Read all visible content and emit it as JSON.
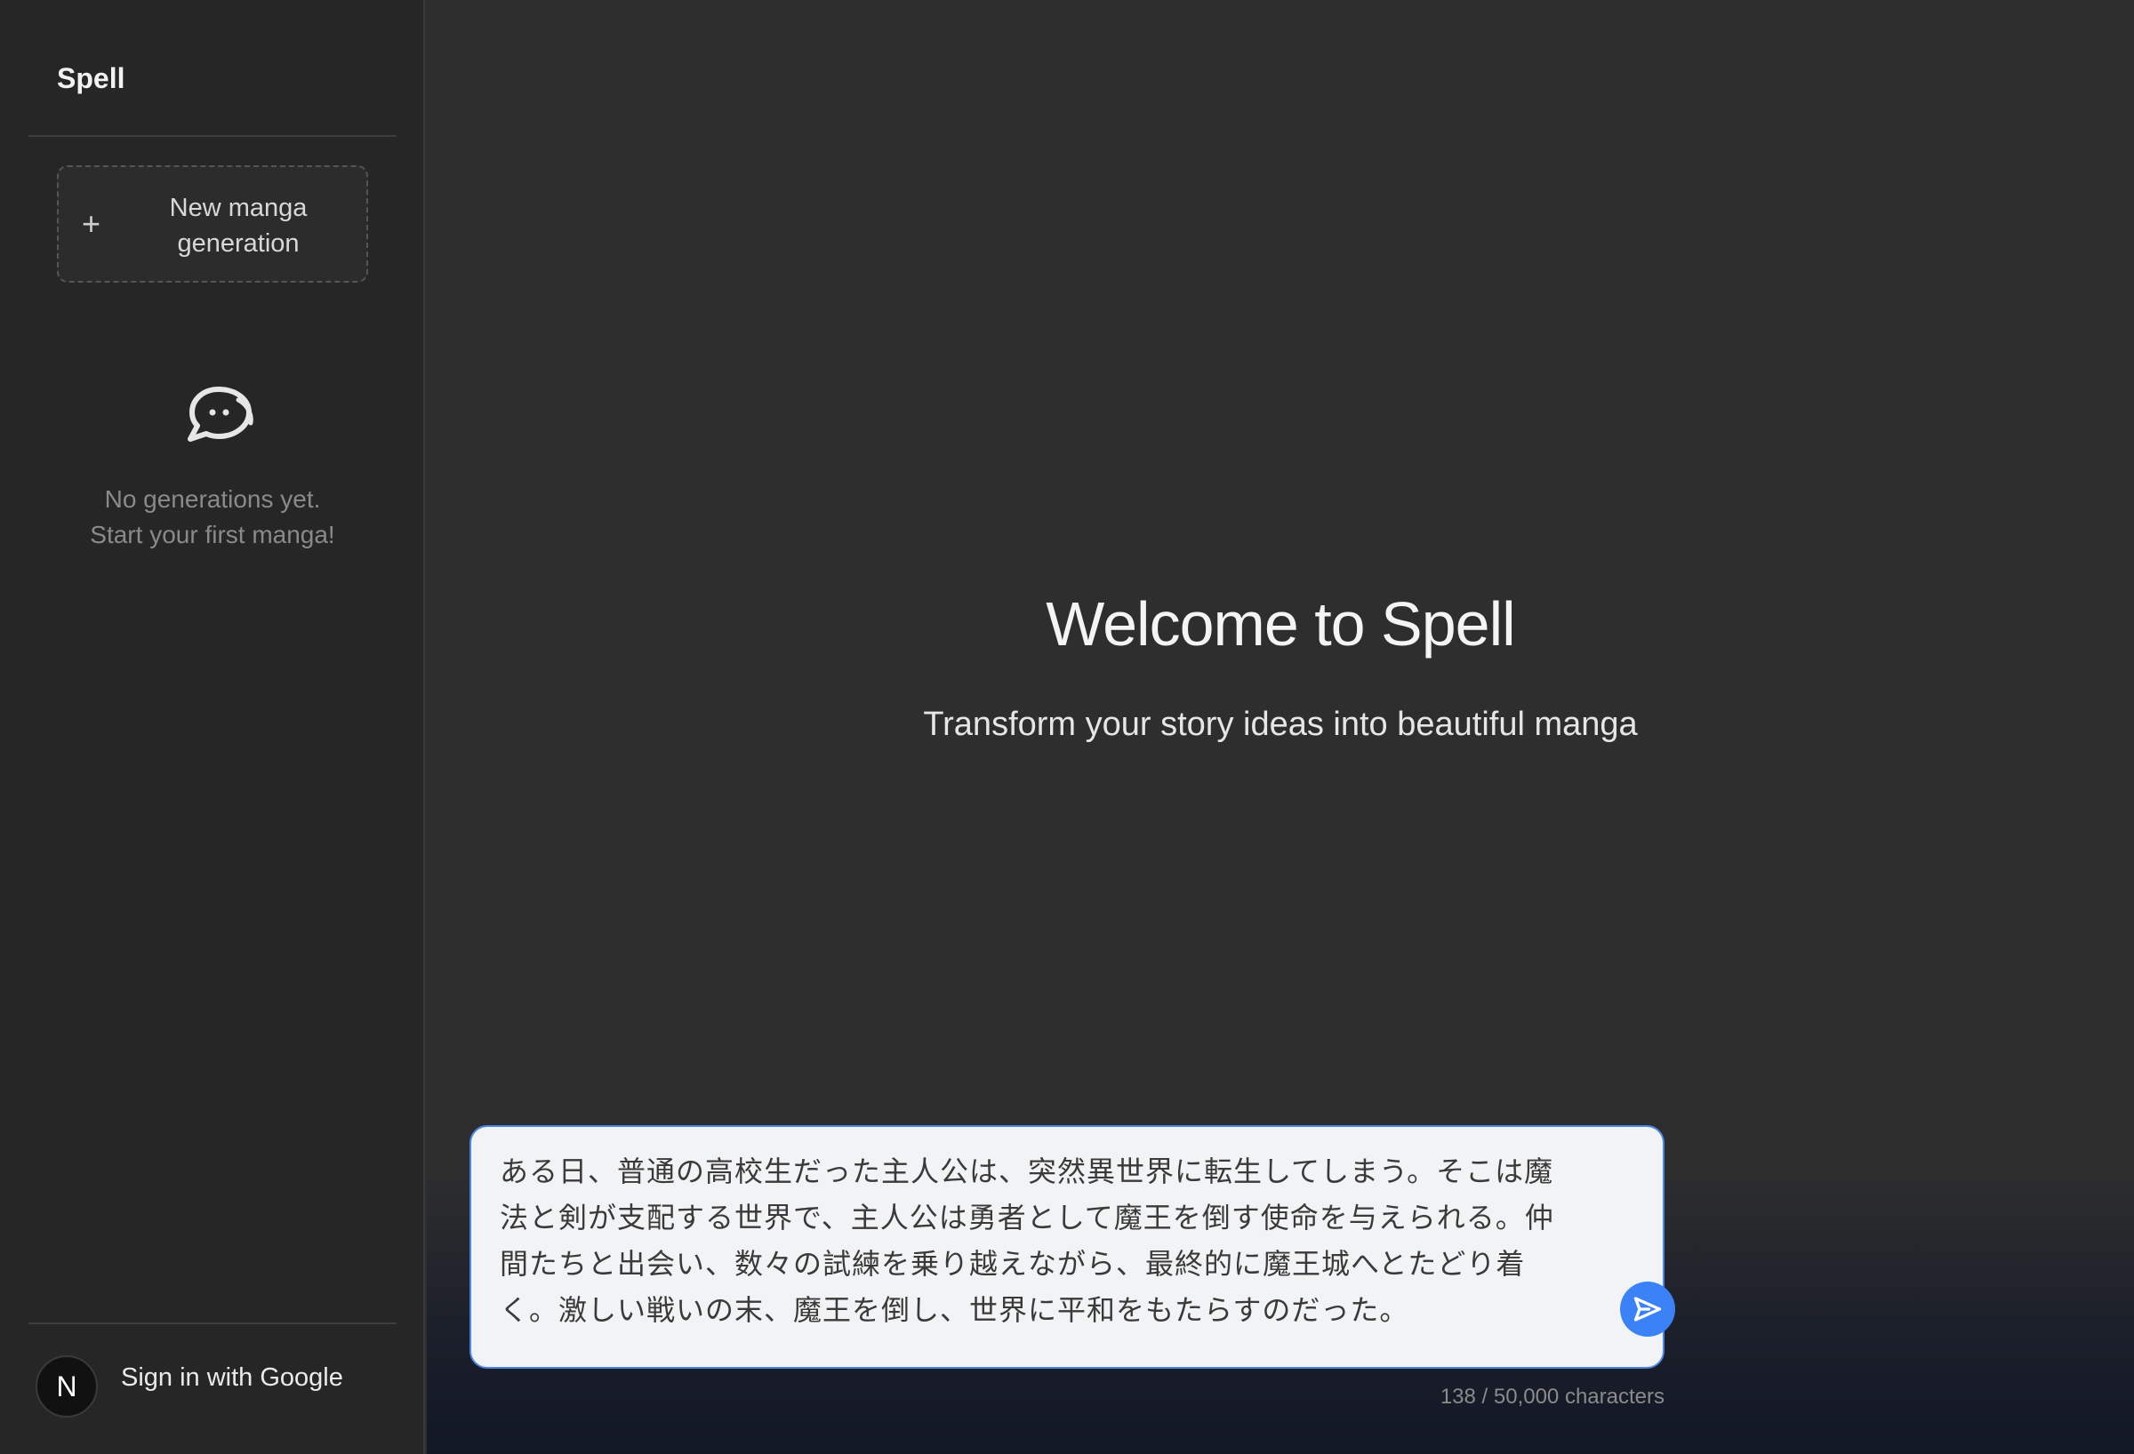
{
  "sidebar": {
    "brand": "Spell",
    "new_button": {
      "icon": "plus-icon",
      "label": "New manga generation"
    },
    "empty_state": {
      "icon": "chat-bubble-icon",
      "line1": "No generations yet.",
      "line2": "Start your first manga!"
    },
    "signin": {
      "avatar_letter": "N",
      "label": "Sign in with Google"
    }
  },
  "main": {
    "title": "Welcome to Spell",
    "subtitle": "Transform your story ideas into beautiful manga",
    "input": {
      "value": "ある日、普通の高校生だった主人公は、突然異世界に転生してしまう。そこは魔法と剣が支配する世界で、主人公は勇者として魔王を倒す使命を与えられる。仲間たちと出会い、数々の試練を乗り越えながら、最終的に魔王城へとたどり着く。激しい戦いの末、魔王を倒し、世界に平和をもたらすのだった。",
      "send_icon": "send-icon"
    },
    "char_count": "138 / 50,000 characters"
  },
  "colors": {
    "accent": "#3b82f6",
    "sidebar_bg": "#262626",
    "main_bg": "#2e2e2e"
  }
}
